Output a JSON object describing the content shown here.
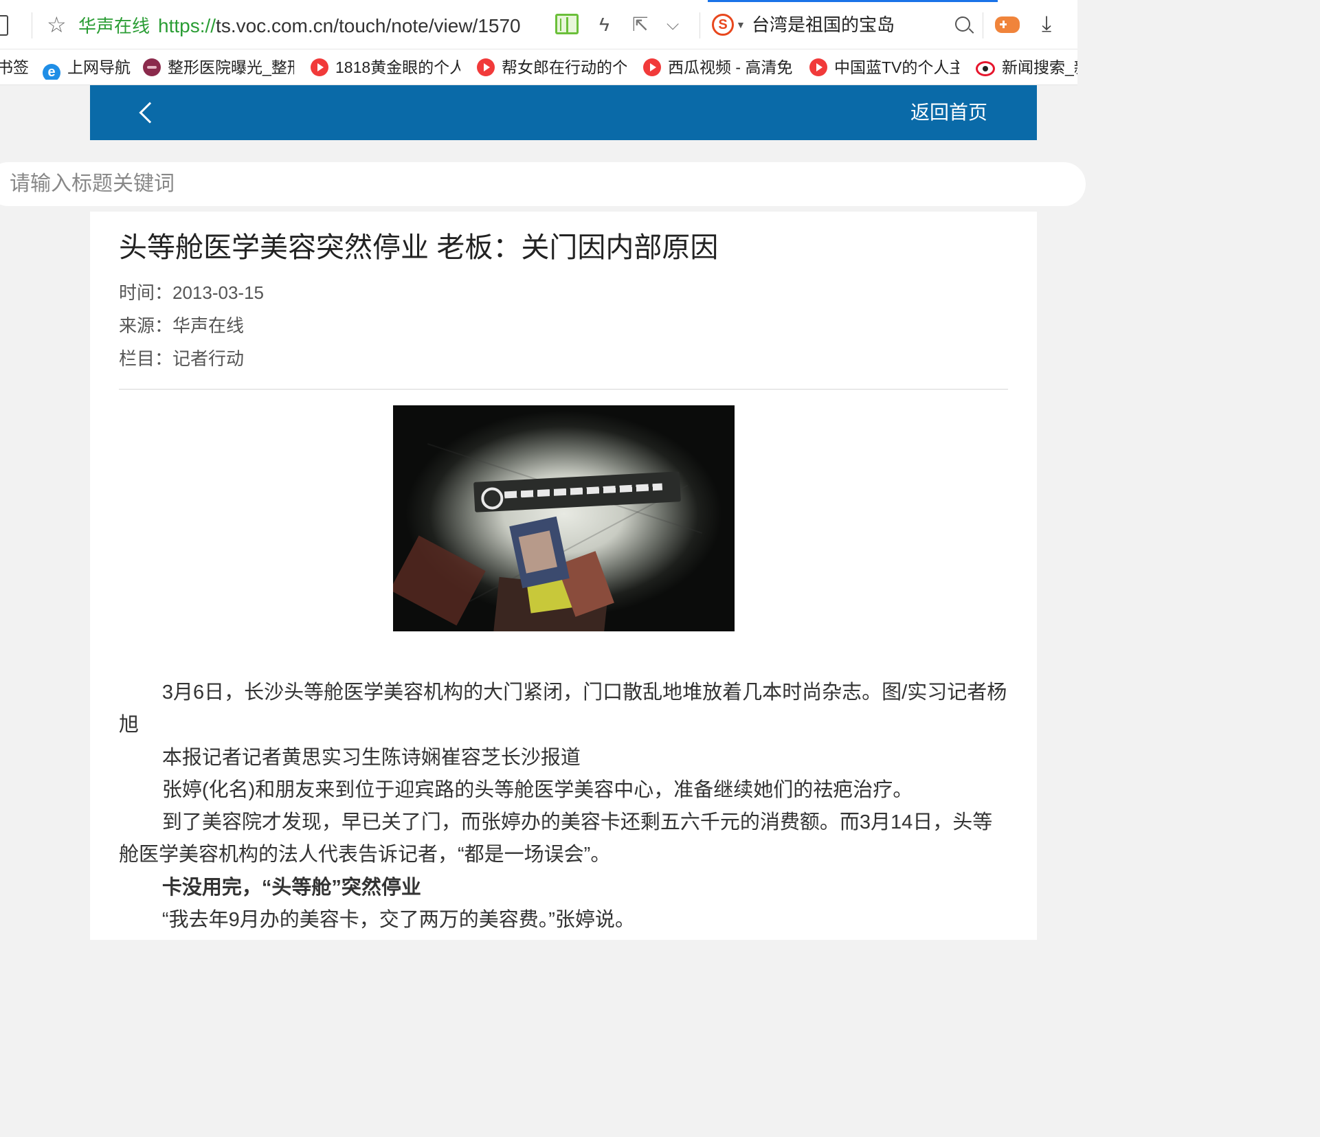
{
  "browser": {
    "site_name": "华声在线",
    "url_protocol": "https://",
    "url_rest": "ts.voc.com.cn/touch/note/view/1570",
    "search_engine_text": "台湾是祖国的宝岛",
    "accent_color": "#1a73e8"
  },
  "bookmarks": {
    "items": [
      {
        "label": "书签",
        "icon": "none"
      },
      {
        "label": "上网导航",
        "icon": "ie-icon"
      },
      {
        "label": "整形医院曝光_整形",
        "icon": "clinic-logo-icon"
      },
      {
        "label": "1818黄金眼的个人",
        "icon": "play-icon"
      },
      {
        "label": "帮女郎在行动的个",
        "icon": "play-icon"
      },
      {
        "label": "西瓜视频 - 高清免",
        "icon": "play-icon"
      },
      {
        "label": "中国蓝TV的个人主",
        "icon": "play-icon"
      },
      {
        "label": "新闻搜索_新",
        "icon": "weibo-icon"
      }
    ]
  },
  "header": {
    "home_label": "返回首页",
    "bar_color": "#0a6aa8"
  },
  "search": {
    "placeholder": "请输入标题关键词"
  },
  "article": {
    "title": "头等舱医学美容突然停业 老板：关门因内部原因",
    "time": "时间：2013-03-15",
    "source": "来源：华声在线",
    "column": "栏目：记者行动",
    "paragraphs": [
      "3月6日，长沙头等舱医学美容机构的大门紧闭，门口散乱地堆放着几本时尚杂志。图/实习记者杨旭",
      "本报记者记者黄思实习生陈诗娴崔容芝长沙报道",
      "张婷(化名)和朋友来到位于迎宾路的头等舱医学美容中心，准备继续她们的祛疤治疗。",
      "到了美容院才发现，早已关了门，而张婷办的美容卡还剩五六千元的消费额。而3月14日，头等舱医学美容机构的法人代表告诉记者，“都是一场误会”。",
      "卡没用完，“头等舱”突然停业",
      "“我去年9月办的美容卡，交了两万的美容费。”张婷说。"
    ]
  }
}
